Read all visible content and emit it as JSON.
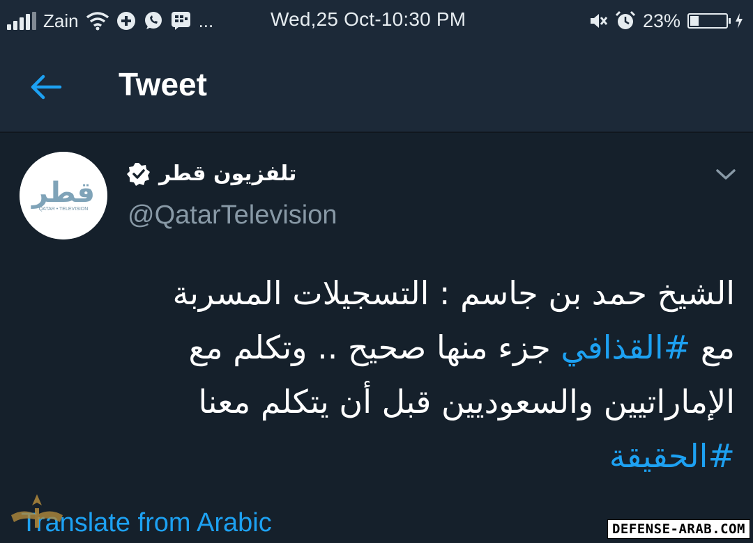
{
  "status_bar": {
    "carrier": "Zain",
    "overflow": "...",
    "datetime": "Wed,25 Oct-10:30 PM",
    "battery_percent": "23%",
    "battery_level": 0.23,
    "icons": [
      "signal-icon",
      "wifi-icon",
      "plus-app-icon",
      "whatsapp-icon",
      "bbm-icon",
      "mute-icon",
      "alarm-icon",
      "battery-icon",
      "charging-icon"
    ]
  },
  "app_bar": {
    "title": "Tweet",
    "back_icon": "arrow-left-icon"
  },
  "tweet": {
    "author_name": "تلفزيون قطر",
    "verified": true,
    "handle": "@QatarTelevision",
    "avatar_text": "قطر",
    "avatar_subtext": "QATAR • TELEVISION",
    "text_lines": [
      {
        "before": "الشيخ حمد بن جاسم :  التسجيلات المسربة",
        "hashtag": "",
        "after": ""
      },
      {
        "before": "مع ",
        "hashtag": "#القذافي",
        "after": " جزء منها صحيح .. وتكلم مع"
      },
      {
        "before": "الإماراتيين والسعوديين قبل أن يتكلم معنا",
        "hashtag": "",
        "after": ""
      },
      {
        "before": "",
        "hashtag": "#الحقيقة",
        "after": ""
      }
    ],
    "translate_link": "Translate from Arabic"
  },
  "watermark": {
    "text": "DEFENSE-ARAB.COM"
  },
  "colors": {
    "background": "#15202b",
    "header": "#1c2938",
    "accent": "#1da1f2",
    "secondary_text": "#8899a6"
  }
}
